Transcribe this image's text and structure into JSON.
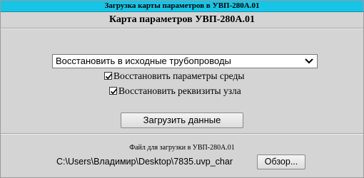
{
  "window": {
    "title": "Загрузка карты параметров в УВП-280А.01",
    "title_bg": "#18c4e6",
    "background": "#d4d4d4"
  },
  "main": {
    "heading": "Карта параметров УВП-280А.01",
    "mode_select": {
      "selected": "Восстановить в исходные трубопроводы",
      "icon": "chevron-down-icon"
    },
    "options": [
      {
        "label": "Восстановить параметры среды",
        "checked": true
      },
      {
        "label": "Восстановить реквизиты узла",
        "checked": true
      }
    ],
    "load_button_label": "Загрузить данные"
  },
  "file": {
    "label": "Файл для загрузки в УВП-280А.01",
    "path": "C:\\Users\\Владимир\\Desktop\\7835.uvp_char",
    "browse_label": "Обзор..."
  }
}
